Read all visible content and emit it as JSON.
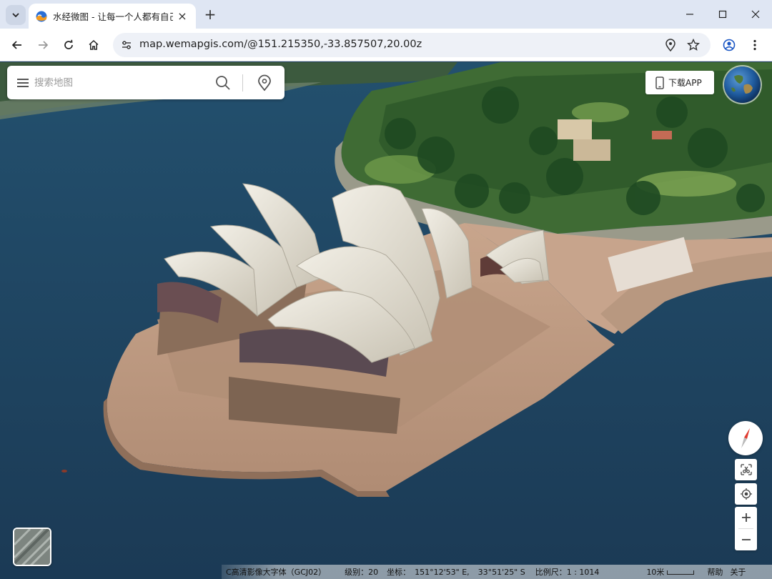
{
  "browser": {
    "tab_title": "水经微图 - 让每一个人都有自己",
    "tab_close": "×",
    "new_tab": "+",
    "url": "map.wemapgis.com/@151.215350,-33.857507,20.00z",
    "window_controls": {
      "minimize": "minimize-icon",
      "maximize": "maximize-icon",
      "close": "close-icon"
    }
  },
  "search": {
    "placeholder": "搜索地图"
  },
  "download_app": {
    "label": "下载APP"
  },
  "status": {
    "layer": "C高清影像大字体（GCJ02）",
    "level_label": "级别：",
    "level_value": "20",
    "coord_label": "坐标：",
    "lon": "151°12'53\" E,",
    "lat": "33°51'25\" S",
    "scale_label": "比例尺：",
    "scale_value": "1 : 1014",
    "scalebar_label": "10米",
    "help": "帮助",
    "about": "关于"
  },
  "colors": {
    "water": "#1f3f5c",
    "chrome_tabbar": "#dfe6f3",
    "compass_red": "#e03a2f"
  }
}
